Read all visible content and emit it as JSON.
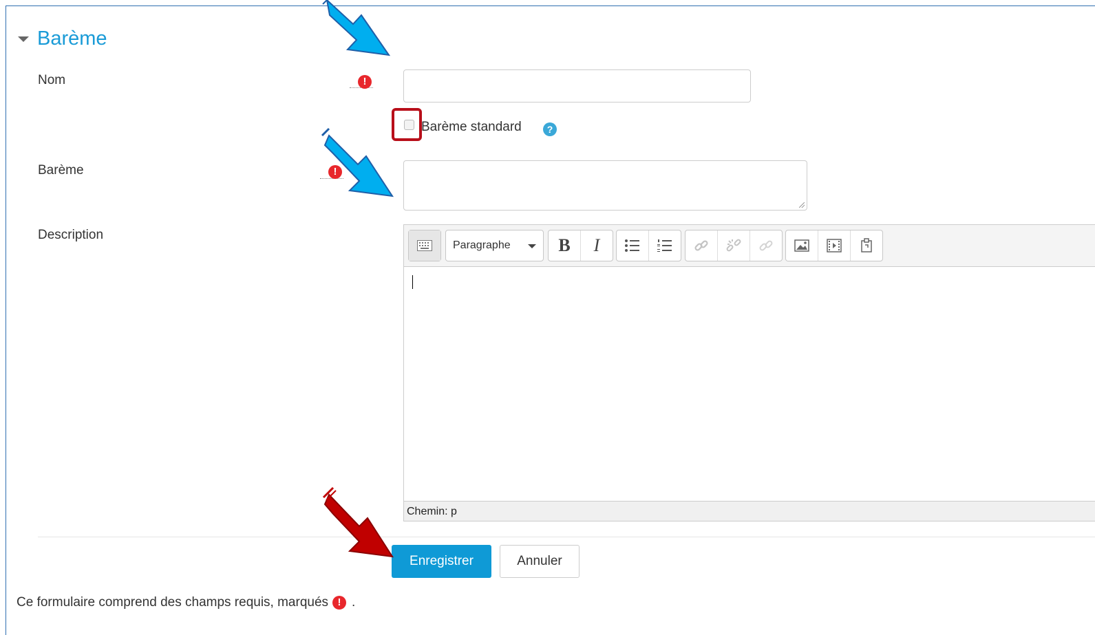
{
  "section": {
    "title": "Barème",
    "toggle_icon": "collapse-caret-icon"
  },
  "fields": {
    "nom": {
      "label": "Nom",
      "value": ""
    },
    "standard": {
      "label": "Barème standard",
      "checked": false,
      "help_icon": "help-icon"
    },
    "bareme": {
      "label": "Barème",
      "value": ""
    },
    "description": {
      "label": "Description"
    }
  },
  "editor": {
    "format": "Paragraphe",
    "toolbar_icons": [
      "toggle-toolbar-icon",
      "bold-icon",
      "italic-icon",
      "unordered-list-icon",
      "ordered-list-icon",
      "link-icon",
      "unlink-icon",
      "anchor-icon",
      "image-icon",
      "media-icon",
      "manage-files-icon"
    ],
    "bold_glyph": "B",
    "italic_glyph": "I",
    "path": "Chemin: p"
  },
  "buttons": {
    "save": "Enregistrer",
    "cancel": "Annuler"
  },
  "footer": {
    "text": "Ce formulaire comprend des champs requis, marqués",
    "period": "."
  },
  "colors": {
    "accent": "#1a9bd7",
    "primary_button": "#0f9ad6",
    "required": "#e8272c",
    "annotation_blue": "#00aeef",
    "annotation_red": "#c00000"
  },
  "required_glyph": "!",
  "help_glyph": "?"
}
